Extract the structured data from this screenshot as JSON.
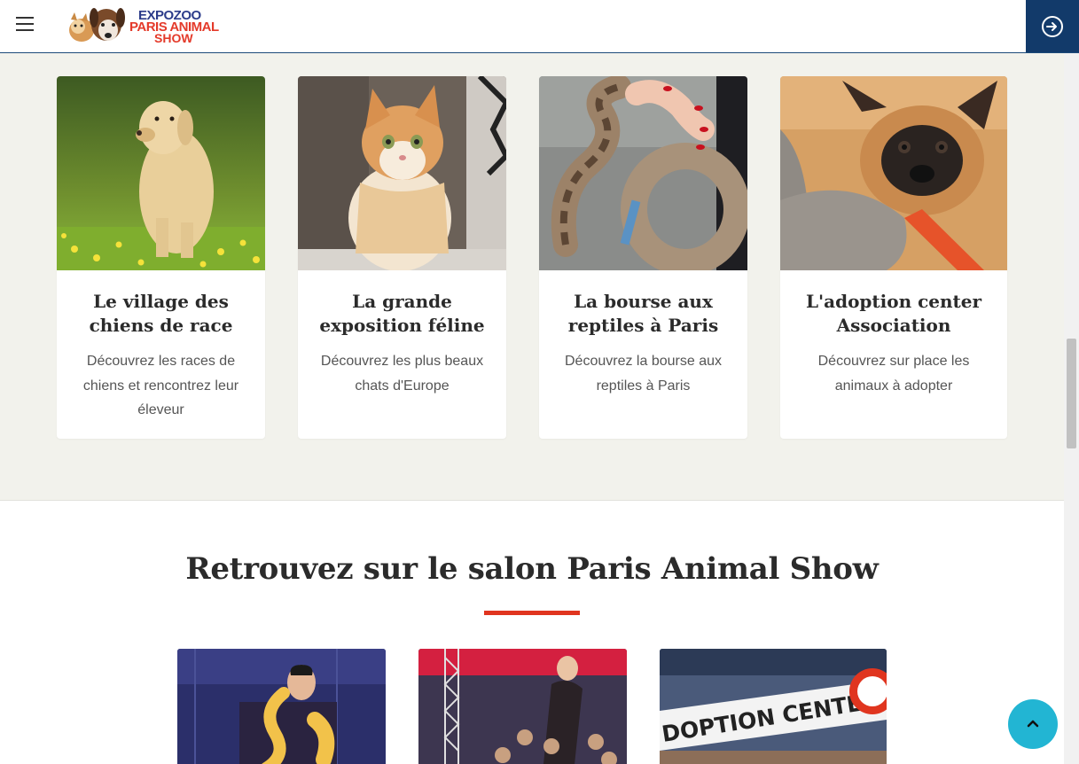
{
  "header": {
    "logo_line1": "EXPOZOO",
    "logo_line2": "PARIS ANIMAL",
    "logo_line3": "SHOW",
    "login_icon": "sign-in-icon",
    "menu_icon": "hamburger-menu-icon"
  },
  "cards": [
    {
      "title": "Le village des chiens de race",
      "description": "Découvrez les races de chiens et rencontrez leur éleveur",
      "image": "labrador-puppy-photo"
    },
    {
      "title": "La grande exposition féline",
      "description": "Découvrez les plus beaux chats d'Europe",
      "image": "ginger-cat-photo"
    },
    {
      "title": "La bourse aux reptiles à Paris",
      "description": "Découvrez la bourse aux reptiles à Paris",
      "image": "python-snake-photo"
    },
    {
      "title": "L'adoption center Association",
      "description": "Découvrez sur place les animaux à adopter",
      "image": "pug-puppy-photo"
    }
  ],
  "section2": {
    "title": "Retrouvez sur le salon Paris Animal Show",
    "photos": [
      "snake-show-photo",
      "dog-show-photo",
      "adoption-center-photo"
    ],
    "adoption_sign": "DOPTION CENTER"
  },
  "colors": {
    "accent_red": "#e0351f",
    "navy": "#123a6a",
    "scroll_top_blue": "#22b5d3",
    "section_bg": "#f2f2ec"
  }
}
